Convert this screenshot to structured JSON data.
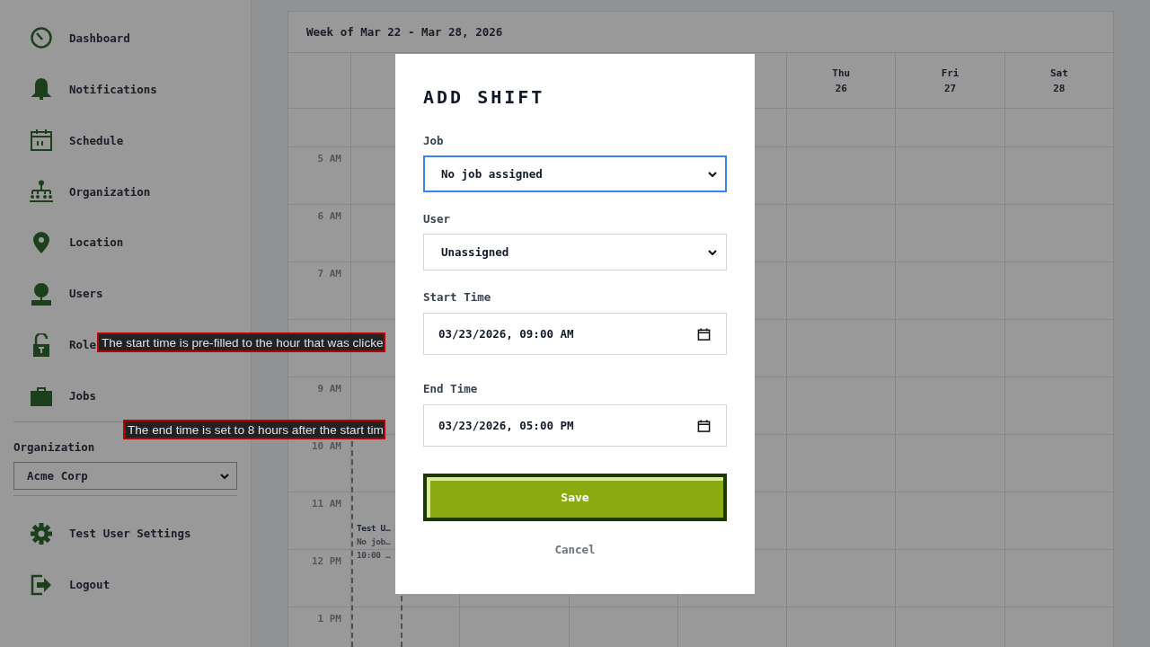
{
  "sidebar": {
    "nav_items": [
      {
        "kind": "gauge",
        "label": "Dashboard"
      },
      {
        "kind": "bell",
        "label": "Notifications"
      },
      {
        "kind": "calendar",
        "label": "Schedule"
      },
      {
        "kind": "org",
        "label": "Organization"
      },
      {
        "kind": "pin",
        "label": "Location"
      },
      {
        "kind": "user",
        "label": "Users"
      },
      {
        "kind": "lock",
        "label": "Role"
      },
      {
        "kind": "briefcase",
        "label": "Jobs"
      }
    ],
    "organization": {
      "label": "Organization",
      "value": "Acme Corp"
    },
    "account_items": [
      {
        "kind": "gear",
        "label": "Test User Settings"
      },
      {
        "kind": "logout",
        "label": "Logout"
      }
    ]
  },
  "calendar": {
    "title": "Week of Mar 22 - Mar 28, 2026",
    "days": [
      {
        "name": "Thu",
        "date": "26"
      },
      {
        "name": "Fri",
        "date": "27"
      },
      {
        "name": "Sat",
        "date": "28"
      }
    ],
    "rows": [
      {
        "kind": "blank"
      },
      {
        "kind": "hour",
        "label": "5 AM"
      },
      {
        "kind": "hour",
        "label": "6 AM"
      },
      {
        "kind": "hour",
        "label": "7 AM"
      },
      {
        "kind": "blank"
      },
      {
        "kind": "hour",
        "label": "9 AM"
      },
      {
        "kind": "hour",
        "label": "10 AM"
      },
      {
        "kind": "hour",
        "label": "11 AM"
      },
      {
        "kind": "hour",
        "label": "12 PM"
      },
      {
        "kind": "hour",
        "label": "1 PM"
      }
    ],
    "event": {
      "lines": [
        "Test U…",
        "No job…",
        "10:00 …"
      ]
    }
  },
  "annotations": [
    {
      "text": "The start time is pre-filled to the hour that was clicke"
    },
    {
      "text": "The end time is set to 8 hours after the start tim"
    }
  ],
  "dialog": {
    "title": "ADD SHIFT",
    "fields": [
      {
        "kind": "select",
        "label": "Job",
        "value": "No job assigned",
        "focused": true
      },
      {
        "kind": "select",
        "label": "User",
        "value": "Unassigned",
        "focused": false
      },
      {
        "kind": "datetime",
        "label": "Start Time",
        "value": "03/23/2026, 09:00 AM",
        "focused": false
      },
      {
        "kind": "datetime",
        "label": "End Time",
        "value": "03/23/2026, 05:00 PM",
        "focused": false
      }
    ],
    "save": "Save",
    "cancel": "Cancel"
  }
}
